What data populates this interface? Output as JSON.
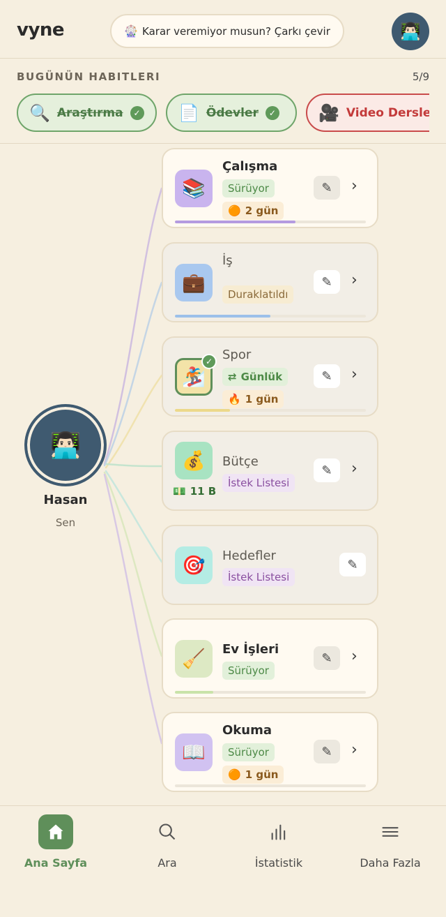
{
  "header": {
    "logo": "vyne",
    "wheel_button_emoji": "🎡",
    "wheel_button_label": "Karar veremiyor musun? Çarkı çevir",
    "avatar_emoji": "👨🏻‍💻"
  },
  "today": {
    "title": "BUGÜNÜN HABITLERI",
    "count": "5/9",
    "chips": [
      {
        "emoji": "🔍",
        "label": "Araştırma",
        "status": "done"
      },
      {
        "emoji": "📄",
        "label": "Ödevler",
        "status": "done"
      },
      {
        "emoji": "🎥",
        "label": "Video Dersle",
        "status": "todo"
      }
    ]
  },
  "user": {
    "emoji": "👨🏻‍💻",
    "name": "Hasan",
    "subtitle": "Sen"
  },
  "habits": [
    {
      "name": "Çalışma",
      "emoji": "📚",
      "icon_bg": "#c9b4ee",
      "status": "Sürüyor",
      "streak": "2 gün",
      "streak_emoji": "🟠",
      "progress": 0.63,
      "color": "#b49be0"
    },
    {
      "name": "İş",
      "emoji": "💼",
      "icon_bg": "#a9c8ef",
      "status": "Duraklatıldı",
      "progress": 0.5,
      "color": "#9cc0ea"
    },
    {
      "name": "Spor",
      "emoji": "🏂",
      "icon_bg": "#f3e3a8",
      "status": "Günlük",
      "status_icon": "⇄",
      "streak": "1 gün",
      "streak_emoji": "🔥",
      "progress": 0.29,
      "color": "#ecd98a"
    },
    {
      "name": "Bütçe",
      "emoji": "💰",
      "icon_bg": "#a8e3c2",
      "status": "İstek Listesi",
      "money_emoji": "💵",
      "money": "11 B",
      "color": "#9edcc0"
    },
    {
      "name": "Hedefler",
      "emoji": "🎯",
      "icon_bg": "#b4ece4",
      "status": "İstek Listesi",
      "color": "#a6e2dc"
    },
    {
      "name": "Ev İşleri",
      "emoji": "🧹",
      "icon_bg": "#dde9c4",
      "status": "Sürüyor",
      "progress": 0.2,
      "color": "#c9e3a9"
    },
    {
      "name": "Okuma",
      "emoji": "📖",
      "icon_bg": "#d1c2f1",
      "status": "Sürüyor",
      "streak": "1 gün",
      "streak_emoji": "🟠",
      "progress": 0.0,
      "color": "#c0aae9"
    }
  ],
  "nav": [
    {
      "label": "Ana Sayfa",
      "icon": "home-icon",
      "active": true
    },
    {
      "label": "Ara",
      "icon": "search-icon",
      "active": false
    },
    {
      "label": "İstatistik",
      "icon": "stats-icon",
      "active": false
    },
    {
      "label": "Daha Fazla",
      "icon": "menu-icon",
      "active": false
    }
  ],
  "glyphs": {
    "check": "✓",
    "edit": "✎",
    "chevron": "›"
  }
}
